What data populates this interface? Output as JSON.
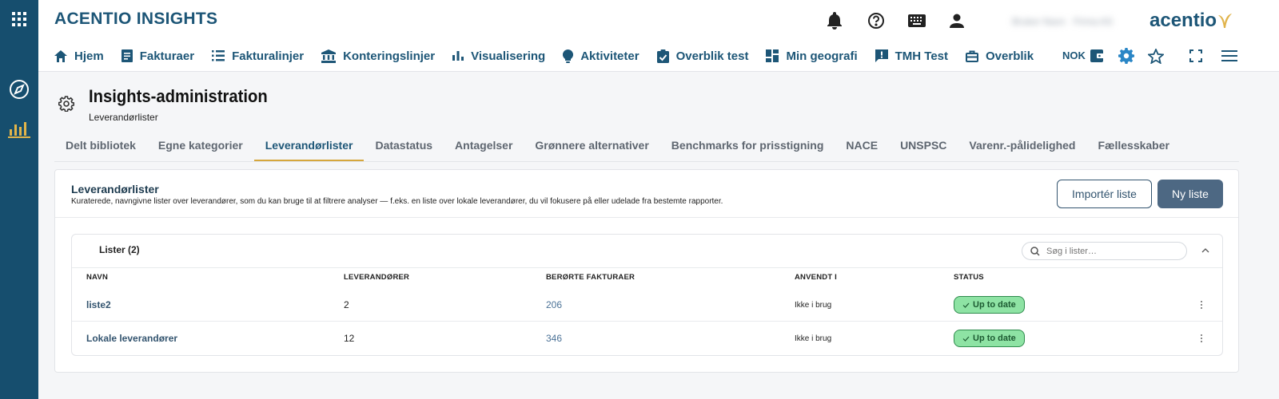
{
  "app": {
    "title": "ACENTIO INSIGHTS",
    "logo_text": "acentio"
  },
  "user": {
    "name": "Bruker Navn",
    "org": "Firma AS"
  },
  "nav": {
    "items": [
      {
        "label": "Hjem",
        "icon": "home-icon"
      },
      {
        "label": "Fakturaer",
        "icon": "document-icon"
      },
      {
        "label": "Fakturalinjer",
        "icon": "list-icon"
      },
      {
        "label": "Konteringslinjer",
        "icon": "bank-icon"
      },
      {
        "label": "Visualisering",
        "icon": "bar-chart-icon"
      },
      {
        "label": "Aktiviteter",
        "icon": "lightbulb-icon"
      },
      {
        "label": "Overblik test",
        "icon": "clipboard-check-icon"
      },
      {
        "label": "Min geografi",
        "icon": "dashboard-icon"
      },
      {
        "label": "TMH Test",
        "icon": "alert-message-icon"
      },
      {
        "label": "Overblik",
        "icon": "briefcase-icon"
      }
    ],
    "currency": "NOK"
  },
  "page": {
    "title": "Insights-administration",
    "subtitle": "Leverandørlister"
  },
  "tabs": [
    {
      "label": "Delt bibliotek",
      "active": false
    },
    {
      "label": "Egne kategorier",
      "active": false
    },
    {
      "label": "Leverandørlister",
      "active": true
    },
    {
      "label": "Datastatus",
      "active": false
    },
    {
      "label": "Antagelser",
      "active": false
    },
    {
      "label": "Grønnere alternativer",
      "active": false
    },
    {
      "label": "Benchmarks for prisstigning",
      "active": false
    },
    {
      "label": "NACE",
      "active": false
    },
    {
      "label": "UNSPSC",
      "active": false
    },
    {
      "label": "Varenr.-pålidelighed",
      "active": false
    },
    {
      "label": "Fællesskaber",
      "active": false
    }
  ],
  "card": {
    "title": "Leverandørlister",
    "description": "Kuraterede, navngivne lister over leverandører, som du kan bruge til at filtrere analyser — f.eks. en liste over lokale leverandører, du vil fokusere på eller udelade fra bestemte rapporter.",
    "import_label": "Importér liste",
    "new_label": "Ny liste"
  },
  "lists": {
    "title": "Lister (2)",
    "search_placeholder": "Søg i lister…",
    "columns": {
      "name": "NAVN",
      "suppliers": "LEVERANDØRER",
      "invoices": "BERØRTE FAKTURAER",
      "used_in": "ANVENDT I",
      "status": "STATUS"
    },
    "rows": [
      {
        "name": "liste2",
        "suppliers": "2",
        "invoices": "206",
        "used_in": "Ikke i brug",
        "status": "Up to date"
      },
      {
        "name": "Lokale leverandører",
        "suppliers": "12",
        "invoices": "346",
        "used_in": "Ikke i brug",
        "status": "Up to date"
      }
    ]
  },
  "colors": {
    "rail": "#164e6e",
    "brand": "#1d5677",
    "tab_accent": "#d6a73d",
    "status_bg": "#8ee3a4",
    "status_border": "#2e8b4c",
    "primary_button": "#4d6883"
  }
}
